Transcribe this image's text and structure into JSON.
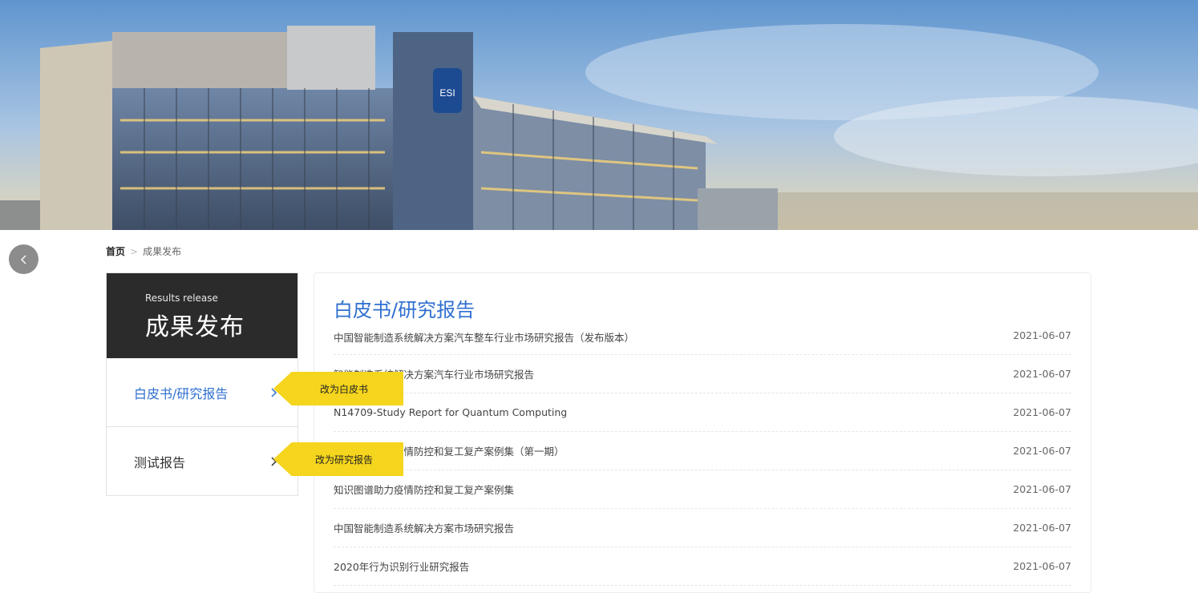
{
  "banner": {
    "logo_text": "ESI"
  },
  "breadcrumb": {
    "home": "首页",
    "current": "成果发布"
  },
  "sidebar": {
    "title_en": "Results release",
    "title_cn": "成果发布",
    "items": [
      {
        "label": "白皮书/研究报告",
        "active": true
      },
      {
        "label": "测试报告",
        "active": false
      }
    ]
  },
  "tooltips": [
    {
      "text": "改为白皮书"
    },
    {
      "text": "改为研究报告"
    }
  ],
  "main": {
    "title": "白皮书/研究报告",
    "articles": [
      {
        "title": "中国智能制造系统解决方案汽车整车行业市场研究报告（发布版本）",
        "date": "2021-06-07"
      },
      {
        "title": "智能制造系统解决方案汽车行业市场研究报告",
        "date": "2021-06-07"
      },
      {
        "title": "N14709-Study Report for Quantum Computing",
        "date": "2021-06-07"
      },
      {
        "title": "知识图谱助力疫情防控和复工复产案例集（第一期）",
        "date": "2021-06-07"
      },
      {
        "title": "知识图谱助力疫情防控和复工复产案例集",
        "date": "2021-06-07"
      },
      {
        "title": "中国智能制造系统解决方案市场研究报告",
        "date": "2021-06-07"
      },
      {
        "title": "2020年行为识别行业研究报告",
        "date": "2021-06-07"
      }
    ]
  },
  "colors": {
    "accent": "#2f6fd0",
    "sidebar_head": "#2b2b2b",
    "tooltip": "#f5d51d"
  }
}
